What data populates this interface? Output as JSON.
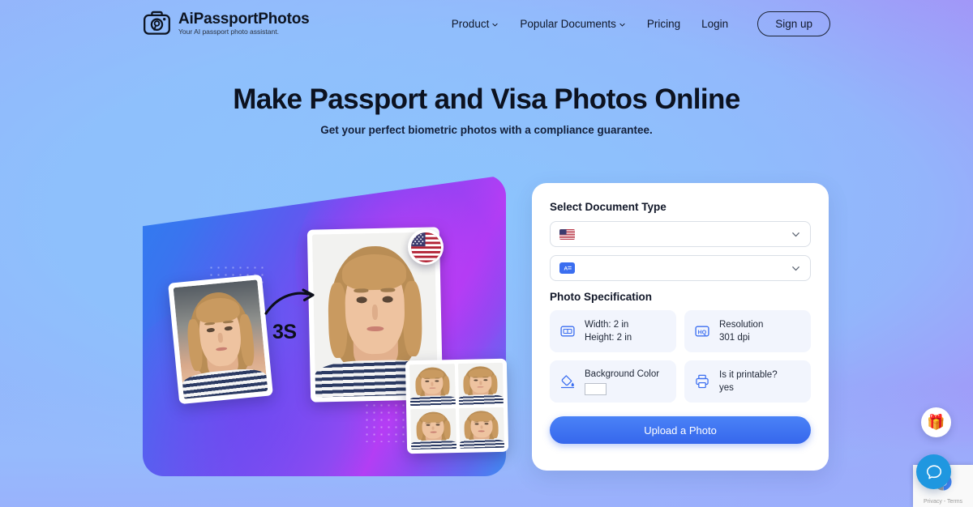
{
  "brand": {
    "name": "AiPassportPhotos",
    "tagline": "Your AI passport photo assistant.",
    "logo_icon": "camera-icon"
  },
  "nav": {
    "items": [
      {
        "label": "Product",
        "has_dropdown": true
      },
      {
        "label": "Popular Documents",
        "has_dropdown": true
      },
      {
        "label": "Pricing",
        "has_dropdown": false
      },
      {
        "label": "Login",
        "has_dropdown": false
      }
    ],
    "signup_label": "Sign up"
  },
  "hero": {
    "title": "Make Passport and Visa Photos Online",
    "subtitle": "Get your perfect biometric photos with a compliance guarantee.",
    "illustration": {
      "speed_label": "3S",
      "arrow_icon": "curved-arrow-icon",
      "flag_badge": "us-flag-icon"
    }
  },
  "form": {
    "document_type_label": "Select Document Type",
    "country_select": {
      "icon": "us-flag-icon",
      "value": "",
      "chevron": "chevron-down-icon"
    },
    "doctype_select": {
      "icon": "document-id-icon",
      "value": "",
      "chevron": "chevron-down-icon"
    },
    "spec_label": "Photo Specification",
    "specs": [
      {
        "icon": "dimensions-icon",
        "line1": "Width: 2 in",
        "line2": "Height: 2 in",
        "type": "text"
      },
      {
        "icon": "resolution-hq-icon",
        "line1": "Resolution",
        "line2": "301 dpi",
        "type": "text"
      },
      {
        "icon": "paint-bucket-icon",
        "line1": "Background Color",
        "line2": "",
        "type": "swatch",
        "swatch_color": "#ffffff"
      },
      {
        "icon": "printer-icon",
        "line1": "Is it printable?",
        "line2": "yes",
        "type": "text"
      }
    ],
    "upload_label": "Upload a Photo"
  },
  "widgets": {
    "gift_icon": "gift-icon",
    "chat_icon": "chat-bubble-icon",
    "recaptcha_text": "Privacy - Terms",
    "recaptcha_icon": "recaptcha-icon"
  },
  "colors": {
    "accent_blue": "#3667ec",
    "bg_left": "#94b5fb",
    "bg_right": "#a493f8",
    "bg_center": "#8bc5fd",
    "chat_blue": "#1f97e0"
  }
}
